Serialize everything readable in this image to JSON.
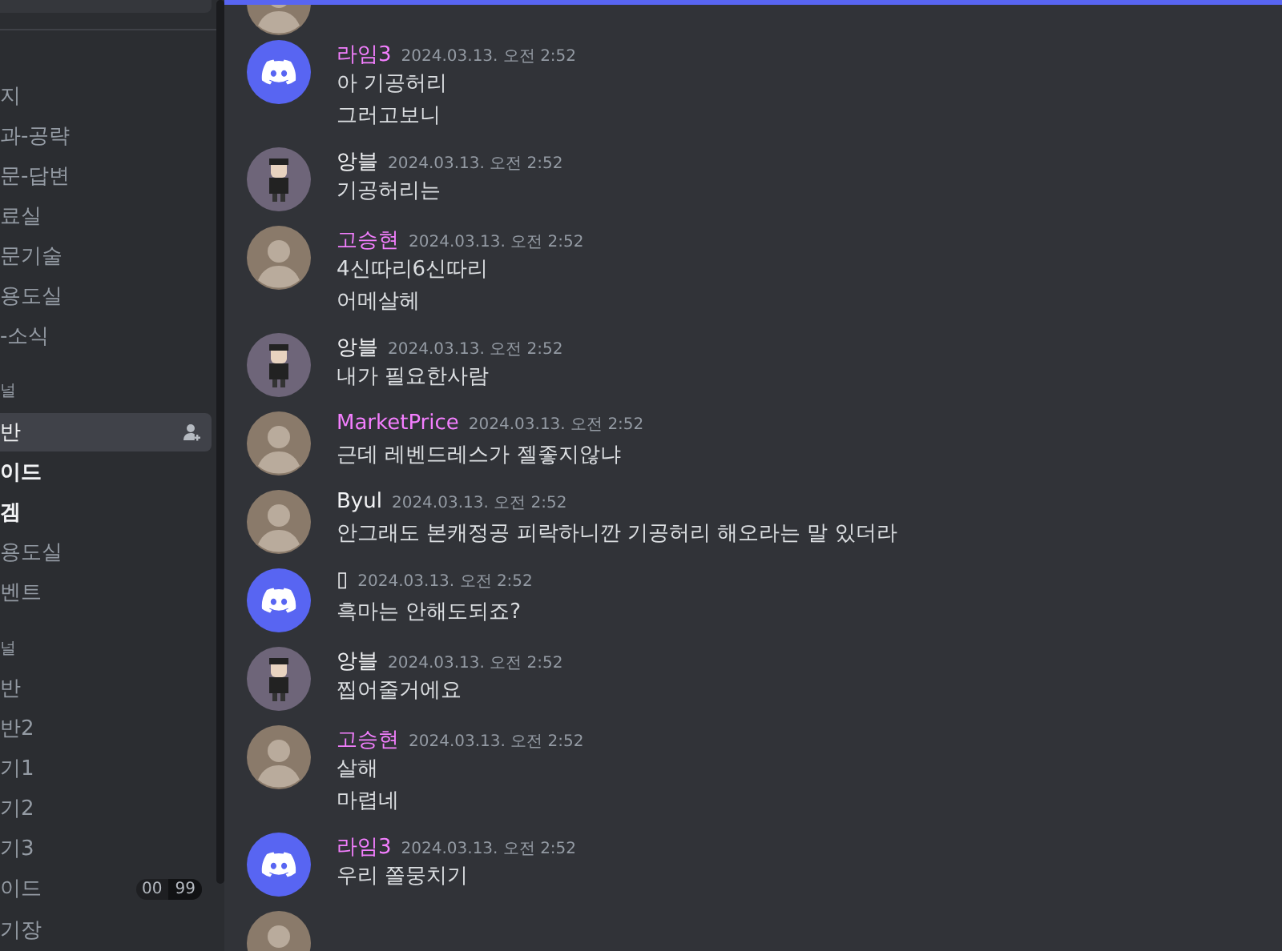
{
  "sidebar": {
    "sections": [
      {
        "items": [
          {
            "label": "지",
            "selected": false,
            "unread": false
          },
          {
            "label": "과-공략",
            "selected": false,
            "unread": false
          },
          {
            "label": "문-답변",
            "selected": false,
            "unread": false
          },
          {
            "label": "료실",
            "selected": false,
            "unread": false
          },
          {
            "label": "문기술",
            "selected": false,
            "unread": false
          },
          {
            "label": "용도실",
            "selected": false,
            "unread": false
          },
          {
            "label": "-소식",
            "selected": false,
            "unread": false
          }
        ]
      },
      {
        "category": "널",
        "items": [
          {
            "label": "반",
            "selected": true,
            "unread": false
          },
          {
            "label": "이드",
            "selected": false,
            "unread": true
          },
          {
            "label": "겜",
            "selected": false,
            "unread": true
          },
          {
            "label": "용도실",
            "selected": false,
            "unread": false
          },
          {
            "label": "벤트",
            "selected": false,
            "unread": false
          }
        ]
      },
      {
        "category": "널",
        "items": [
          {
            "label": "반",
            "selected": false,
            "unread": false
          },
          {
            "label": "반2",
            "selected": false,
            "unread": false
          },
          {
            "label": "기1",
            "selected": false,
            "unread": false
          },
          {
            "label": "기2",
            "selected": false,
            "unread": false
          },
          {
            "label": "기3",
            "selected": false,
            "unread": false
          },
          {
            "label": "이드",
            "selected": false,
            "unread": false,
            "badges": [
              "00",
              "99"
            ]
          },
          {
            "label": "기장",
            "selected": false,
            "unread": false
          }
        ]
      }
    ]
  },
  "messages": [
    {
      "author": "라임3",
      "color": "#f47fff",
      "kind": "discord",
      "time": "2024.03.13. 오전 2:52",
      "lines": [
        "아 기공허리",
        "그러고보니"
      ]
    },
    {
      "author": "앙블",
      "color": "#f2f3f5",
      "kind": "cartoon",
      "time": "2024.03.13. 오전 2:52",
      "lines": [
        "기공허리는"
      ]
    },
    {
      "author": "고승현",
      "color": "#f47fff",
      "kind": "photo",
      "time": "2024.03.13. 오전 2:52",
      "lines": [
        "4신따리6신따리",
        "어메살헤"
      ]
    },
    {
      "author": "앙블",
      "color": "#f2f3f5",
      "kind": "cartoon",
      "time": "2024.03.13. 오전 2:52",
      "lines": [
        "내가 필요한사람"
      ]
    },
    {
      "author": "MarketPrice",
      "color": "#f47fff",
      "kind": "photo",
      "time": "2024.03.13. 오전 2:52",
      "lines": [
        "근데 레벤드레스가 젤좋지않냐"
      ]
    },
    {
      "author": "Byul",
      "color": "#f2f3f5",
      "kind": "photo",
      "time": "2024.03.13. 오전 2:52",
      "lines": [
        "안그래도 본캐정공 피락하니깐 기공허리 해오라는 말 있더라"
      ]
    },
    {
      "author": "▯",
      "color": "#f2f3f5",
      "kind": "discord",
      "time": "2024.03.13. 오전 2:52",
      "lines": [
        "흑마는 안해도되죠?"
      ]
    },
    {
      "author": "앙블",
      "color": "#f2f3f5",
      "kind": "cartoon",
      "time": "2024.03.13. 오전 2:52",
      "lines": [
        "찝어줄거에요"
      ]
    },
    {
      "author": "고승현",
      "color": "#f47fff",
      "kind": "photo",
      "time": "2024.03.13. 오전 2:52",
      "lines": [
        "살해",
        "마렵네"
      ]
    },
    {
      "author": "라임3",
      "color": "#f47fff",
      "kind": "discord",
      "time": "2024.03.13. 오전 2:52",
      "lines": [
        "우리 쫄뭉치기"
      ]
    }
  ]
}
